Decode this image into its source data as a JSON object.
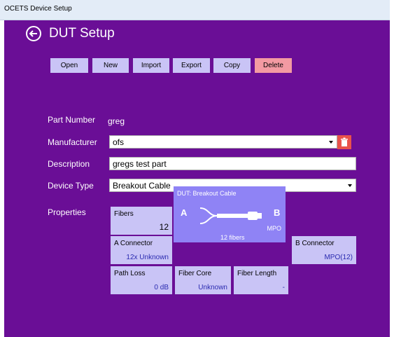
{
  "window": {
    "title": "OCETS Device Setup"
  },
  "header": {
    "title": "DUT Setup"
  },
  "toolbar": {
    "open": "Open",
    "new": "New",
    "import": "Import",
    "export": "Export",
    "copy": "Copy",
    "delete": "Delete"
  },
  "form": {
    "part_number_label": "Part Number",
    "part_number_value": "greg",
    "manufacturer_label": "Manufacturer",
    "manufacturer_value": "ofs",
    "description_label": "Description",
    "description_value": "gregs test part",
    "device_type_label": "Device Type",
    "device_type_value": "Breakout Cable"
  },
  "properties": {
    "label": "Properties",
    "fibers": {
      "title": "Fibers",
      "value": "12"
    },
    "a_connector": {
      "title": "A Connector",
      "value": "12x Unknown"
    },
    "path_loss": {
      "title": "Path Loss",
      "value": "0 dB"
    },
    "fiber_core": {
      "title": "Fiber Core",
      "value": "Unknown"
    },
    "fiber_length": {
      "title": "Fiber Length",
      "value": "-"
    },
    "b_connector": {
      "title": "B Connector",
      "value": "MPO(12)"
    },
    "dut": {
      "title": "DUT: Breakout Cable",
      "side_a": "A",
      "side_b": "B",
      "connector": "MPO",
      "fibers_caption": "12 fibers"
    }
  },
  "colors": {
    "background": "#6a0e96",
    "button": "#c9c4f6",
    "delete_button": "#f39aa2",
    "dut_tile": "#8f83f5",
    "trash": "#e9524b"
  }
}
